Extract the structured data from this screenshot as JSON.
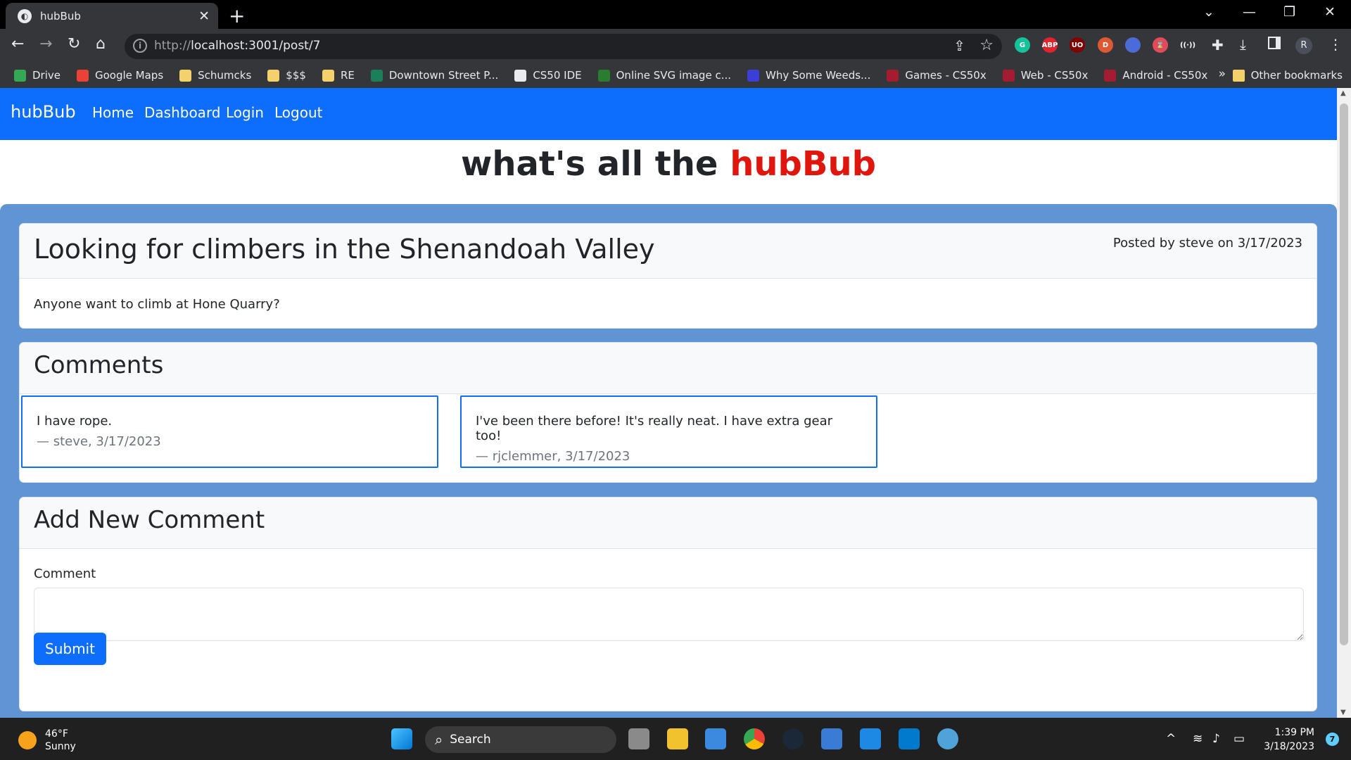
{
  "browser": {
    "tab_title": "hubBub",
    "url_prefix": "http://",
    "url_host": "localhost",
    "url_path": ":3001/post/7",
    "tab_close": "✕",
    "new_tab": "+",
    "bookmarks": [
      {
        "label": "Drive",
        "icon": "drive-icon",
        "color": "#34a853"
      },
      {
        "label": "Google Maps",
        "icon": "maps-icon",
        "color": "#ea4335"
      },
      {
        "label": "Schumcks",
        "icon": "folder-icon",
        "color": "#f4d16b"
      },
      {
        "label": "$$$",
        "icon": "folder-icon",
        "color": "#f4d16b"
      },
      {
        "label": "RE",
        "icon": "folder-icon",
        "color": "#f4d16b"
      },
      {
        "label": "Downtown Street P...",
        "icon": "site-icon",
        "color": "#1b7f5a"
      },
      {
        "label": "CS50 IDE",
        "icon": "site-icon",
        "color": "#e8eaed"
      },
      {
        "label": "Online SVG image c...",
        "icon": "site-icon",
        "color": "#2a7d2e"
      },
      {
        "label": "Why Some Weeds...",
        "icon": "site-icon",
        "color": "#3b3fd8"
      },
      {
        "label": "Games - CS50x",
        "icon": "harvard-icon",
        "color": "#a51c30"
      },
      {
        "label": "Web - CS50x",
        "icon": "harvard-icon",
        "color": "#a51c30"
      },
      {
        "label": "Android - CS50x",
        "icon": "harvard-icon",
        "color": "#a51c30"
      }
    ],
    "bookmarks_more": "»",
    "other_bookmarks": "Other bookmarks",
    "extensions": [
      {
        "name": "grammarly-icon",
        "label": "G",
        "color": "#15c39a"
      },
      {
        "name": "adblock-icon",
        "label": "ABP",
        "color": "#e0242d"
      },
      {
        "name": "ublock-icon",
        "label": "UO",
        "color": "#800000"
      },
      {
        "name": "duckduckgo-icon",
        "label": "D",
        "color": "#de5833"
      },
      {
        "name": "dropper-icon",
        "label": "",
        "color": "#4b6bd8"
      },
      {
        "name": "timer-icon",
        "label": "⌛",
        "color": "#e04a5a"
      },
      {
        "name": "radio-icon",
        "label": "((·))",
        "color": "#35363a"
      }
    ],
    "profile": "R"
  },
  "site": {
    "brand": "hubBub",
    "nav": [
      "Home",
      "Dashboard",
      "Login",
      "Logout"
    ],
    "hero_prefix": "what's all the ",
    "hero_accent": "hubBub",
    "accent_color": "#e0160e",
    "primary_color": "#0d6efd"
  },
  "post": {
    "title": "Looking for climbers in the Shenandoah Valley",
    "meta": "Posted by steve on 3/17/2023",
    "body": "Anyone want to climb at Hone Quarry?"
  },
  "comments": {
    "heading": "Comments",
    "items": [
      {
        "text": "I have rope.",
        "by": "— steve, 3/17/2023"
      },
      {
        "text": "I've been there before! It's really neat. I have extra gear too!",
        "by": "— rjclemmer, 3/17/2023"
      }
    ]
  },
  "add_comment": {
    "heading": "Add New Comment",
    "label": "Comment",
    "value": "",
    "submit": "Submit"
  },
  "taskbar": {
    "temp": "46°F",
    "condition": "Sunny",
    "search": "Search",
    "time": "1:39 PM",
    "date": "3/18/2023",
    "notifications": "7"
  }
}
